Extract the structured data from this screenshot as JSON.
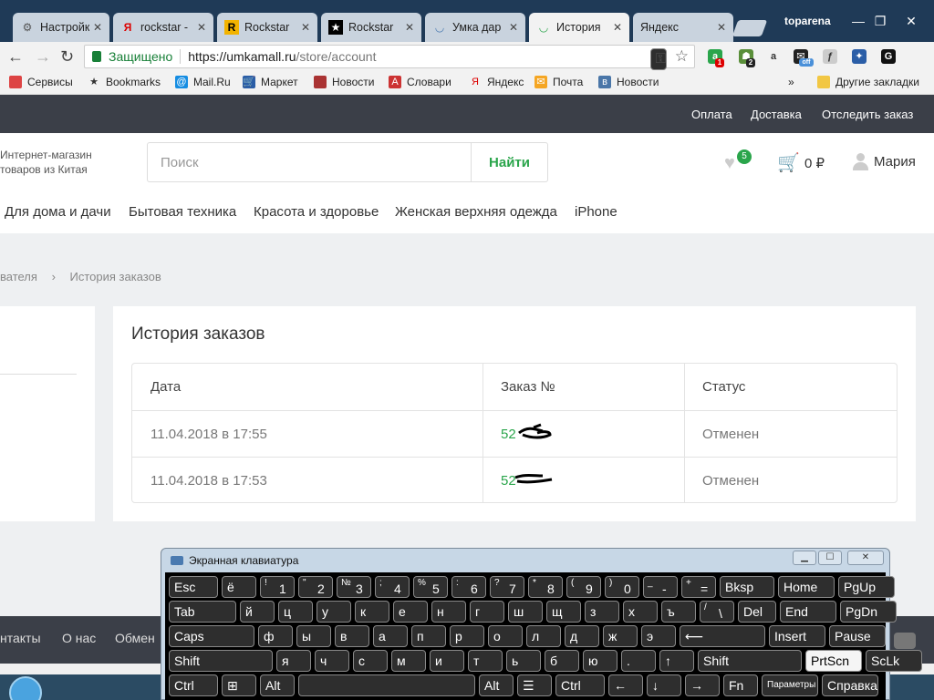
{
  "browser": {
    "tabs": [
      {
        "label": "Настройки",
        "icon": "gear-icon"
      },
      {
        "label": "rockstar -",
        "icon": "yandex-icon"
      },
      {
        "label": "Rockstar",
        "icon": "rockstar-icon"
      },
      {
        "label": "Rockstar",
        "icon": "rockstar-star-icon"
      },
      {
        "label": "Умка дар",
        "icon": "umka-icon"
      },
      {
        "label": "История",
        "icon": "umka-icon"
      },
      {
        "label": "Яндекс",
        "icon": "yandex-icon"
      }
    ],
    "profile": "toparena",
    "secure_label": "Защищено",
    "url_host": "https://umkamall.ru",
    "url_path": "/store/account",
    "bookmarks": [
      "Сервисы",
      "Bookmarks",
      "Mail.Ru",
      "Маркет",
      "Новости",
      "Словари",
      "Яндекс",
      "Почта",
      "Новости"
    ],
    "other_bookmarks": "Другие закладки",
    "ext_badges": [
      "1",
      "2",
      "off"
    ]
  },
  "site": {
    "topnav": [
      "Оплата",
      "Доставка",
      "Отследить заказ"
    ],
    "tagline": "Интернет-магазин товаров из Китая",
    "search_placeholder": "Поиск",
    "search_button": "Найти",
    "wishlist_count": "5",
    "cart_total": "0 ₽",
    "user_name": "Мария",
    "categories": [
      "Для дома и дачи",
      "Бытовая техника",
      "Красота и здоровье",
      "Женская верхняя одежда",
      "iPhone"
    ],
    "breadcrumb": [
      "вателя",
      "История заказов"
    ],
    "breadcrumb_sep": "›",
    "page_title": "История заказов",
    "orders": {
      "headers": [
        "Дата",
        "Заказ №",
        "Статус"
      ],
      "rows": [
        {
          "date": "11.04.2018 в 17:55",
          "number": "52",
          "status": "Отменен"
        },
        {
          "date": "11.04.2018 в 17:53",
          "number": "52",
          "status": "Отменен"
        }
      ]
    },
    "footer_links": [
      "нтакты",
      "О нас",
      "Обмен"
    ]
  },
  "osk": {
    "title": "Экранная клавиатура",
    "rows": [
      [
        {
          "l": "Esc"
        },
        {
          "l": "ё"
        },
        {
          "l": "1",
          "s": "!"
        },
        {
          "l": "2",
          "s": "\""
        },
        {
          "l": "3",
          "s": "№"
        },
        {
          "l": "4",
          "s": ";"
        },
        {
          "l": "5",
          "s": "%"
        },
        {
          "l": "6",
          "s": ":"
        },
        {
          "l": "7",
          "s": "?"
        },
        {
          "l": "8",
          "s": "*"
        },
        {
          "l": "9",
          "s": "("
        },
        {
          "l": "0",
          "s": ")"
        },
        {
          "l": "-",
          "s": "_"
        },
        {
          "l": "=",
          "s": "+"
        },
        {
          "l": "Bksp"
        },
        {
          "l": "Home"
        },
        {
          "l": "PgUp"
        }
      ],
      [
        {
          "l": "Tab"
        },
        {
          "l": "й"
        },
        {
          "l": "ц"
        },
        {
          "l": "у"
        },
        {
          "l": "к"
        },
        {
          "l": "е"
        },
        {
          "l": "н"
        },
        {
          "l": "г"
        },
        {
          "l": "ш"
        },
        {
          "l": "щ"
        },
        {
          "l": "з"
        },
        {
          "l": "х"
        },
        {
          "l": "ъ"
        },
        {
          "l": "\\",
          "s": "/"
        },
        {
          "l": "Del"
        },
        {
          "l": "End"
        },
        {
          "l": "PgDn"
        }
      ],
      [
        {
          "l": "Caps"
        },
        {
          "l": "ф"
        },
        {
          "l": "ы"
        },
        {
          "l": "в"
        },
        {
          "l": "а"
        },
        {
          "l": "п"
        },
        {
          "l": "р"
        },
        {
          "l": "о"
        },
        {
          "l": "л"
        },
        {
          "l": "д"
        },
        {
          "l": "ж"
        },
        {
          "l": "э"
        },
        {
          "l": "⟵"
        },
        {
          "l": "Insert"
        },
        {
          "l": "Pause"
        }
      ],
      [
        {
          "l": "Shift"
        },
        {
          "l": "я"
        },
        {
          "l": "ч"
        },
        {
          "l": "с"
        },
        {
          "l": "м"
        },
        {
          "l": "и"
        },
        {
          "l": "т"
        },
        {
          "l": "ь"
        },
        {
          "l": "б"
        },
        {
          "l": "ю"
        },
        {
          "l": "."
        },
        {
          "l": "↑"
        },
        {
          "l": "Shift"
        },
        {
          "l": "PrtScn"
        },
        {
          "l": "ScLk"
        }
      ],
      [
        {
          "l": "Ctrl"
        },
        {
          "l": "⊞"
        },
        {
          "l": "Alt"
        },
        {
          "l": ""
        },
        {
          "l": "Alt"
        },
        {
          "l": "☰"
        },
        {
          "l": "Ctrl"
        },
        {
          "l": "←"
        },
        {
          "l": "↓"
        },
        {
          "l": "→"
        },
        {
          "l": "Fn"
        },
        {
          "l": "Параметры"
        },
        {
          "l": "Справка"
        }
      ]
    ]
  }
}
